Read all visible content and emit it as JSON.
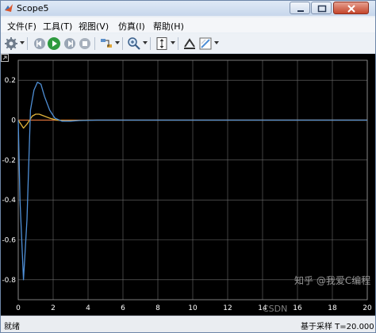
{
  "window": {
    "title": "Scope5"
  },
  "menu": [
    "文件(F)",
    "工具(T)",
    "视图(V)",
    "仿真(I)",
    "帮助(H)"
  ],
  "toolbar_icons": [
    "gear-icon",
    "step-back-icon",
    "run-icon",
    "step-forward-icon",
    "stop-icon",
    "highlight-icon",
    "zoom-icon",
    "scale-axes-icon",
    "cursor-measure-icon",
    "style-icon"
  ],
  "status": {
    "left": "就绪",
    "right": "基于采样 T=20.000"
  },
  "chart_data": {
    "type": "line",
    "xlim": [
      0,
      20
    ],
    "ylim": [
      -0.9,
      0.3
    ],
    "x_ticks": [
      "0",
      "2",
      "4",
      "6",
      "8",
      "10",
      "12",
      "14",
      "16",
      "18",
      "20"
    ],
    "y_ticks": [
      "0.2",
      "0",
      "-0.2",
      "-0.4",
      "-0.6",
      "-0.8"
    ],
    "grid": true,
    "series": [
      {
        "color": "#4f8fd6",
        "x": [
          0,
          0.1,
          0.3,
          0.5,
          0.7,
          0.9,
          1.1,
          1.3,
          1.5,
          1.8,
          2.1,
          2.5,
          3.0,
          3.5,
          4.5,
          6,
          20
        ],
        "y": [
          0,
          -0.4,
          -0.8,
          -0.5,
          0.05,
          0.15,
          0.19,
          0.18,
          0.12,
          0.05,
          0.01,
          -0.005,
          -0.005,
          -0.002,
          0,
          0,
          0
        ]
      },
      {
        "color": "#e1b43a",
        "x": [
          0,
          0.15,
          0.3,
          0.5,
          0.8,
          1.0,
          1.2,
          1.5,
          1.8,
          2.2,
          2.7,
          3.3,
          4,
          20
        ],
        "y": [
          0,
          -0.02,
          -0.04,
          -0.02,
          0.02,
          0.03,
          0.03,
          0.02,
          0.01,
          0,
          -0.003,
          -0.002,
          0,
          0
        ]
      },
      {
        "color": "#d9703a",
        "x": [
          0,
          20
        ],
        "y": [
          0,
          0
        ]
      }
    ]
  },
  "watermark": {
    "text": "知乎 @我爱C编程",
    "subtext": "CSDN"
  },
  "colors": {
    "plot_bg": "#000000",
    "grid": "#6e6e6e",
    "axis_text": "#ffffff"
  }
}
